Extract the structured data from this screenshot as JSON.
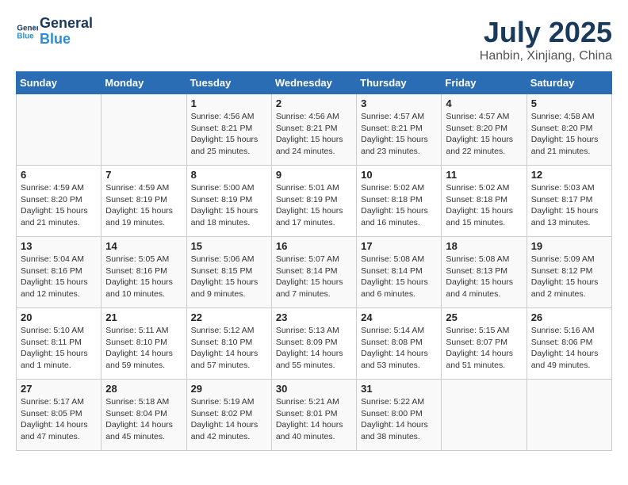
{
  "header": {
    "logo_line1": "General",
    "logo_line2": "Blue",
    "month": "July 2025",
    "location": "Hanbin, Xinjiang, China"
  },
  "days_of_week": [
    "Sunday",
    "Monday",
    "Tuesday",
    "Wednesday",
    "Thursday",
    "Friday",
    "Saturday"
  ],
  "weeks": [
    [
      {
        "day": "",
        "info": ""
      },
      {
        "day": "",
        "info": ""
      },
      {
        "day": "1",
        "info": "Sunrise: 4:56 AM\nSunset: 8:21 PM\nDaylight: 15 hours and 25 minutes."
      },
      {
        "day": "2",
        "info": "Sunrise: 4:56 AM\nSunset: 8:21 PM\nDaylight: 15 hours and 24 minutes."
      },
      {
        "day": "3",
        "info": "Sunrise: 4:57 AM\nSunset: 8:21 PM\nDaylight: 15 hours and 23 minutes."
      },
      {
        "day": "4",
        "info": "Sunrise: 4:57 AM\nSunset: 8:20 PM\nDaylight: 15 hours and 22 minutes."
      },
      {
        "day": "5",
        "info": "Sunrise: 4:58 AM\nSunset: 8:20 PM\nDaylight: 15 hours and 21 minutes."
      }
    ],
    [
      {
        "day": "6",
        "info": "Sunrise: 4:59 AM\nSunset: 8:20 PM\nDaylight: 15 hours and 21 minutes."
      },
      {
        "day": "7",
        "info": "Sunrise: 4:59 AM\nSunset: 8:19 PM\nDaylight: 15 hours and 19 minutes."
      },
      {
        "day": "8",
        "info": "Sunrise: 5:00 AM\nSunset: 8:19 PM\nDaylight: 15 hours and 18 minutes."
      },
      {
        "day": "9",
        "info": "Sunrise: 5:01 AM\nSunset: 8:19 PM\nDaylight: 15 hours and 17 minutes."
      },
      {
        "day": "10",
        "info": "Sunrise: 5:02 AM\nSunset: 8:18 PM\nDaylight: 15 hours and 16 minutes."
      },
      {
        "day": "11",
        "info": "Sunrise: 5:02 AM\nSunset: 8:18 PM\nDaylight: 15 hours and 15 minutes."
      },
      {
        "day": "12",
        "info": "Sunrise: 5:03 AM\nSunset: 8:17 PM\nDaylight: 15 hours and 13 minutes."
      }
    ],
    [
      {
        "day": "13",
        "info": "Sunrise: 5:04 AM\nSunset: 8:16 PM\nDaylight: 15 hours and 12 minutes."
      },
      {
        "day": "14",
        "info": "Sunrise: 5:05 AM\nSunset: 8:16 PM\nDaylight: 15 hours and 10 minutes."
      },
      {
        "day": "15",
        "info": "Sunrise: 5:06 AM\nSunset: 8:15 PM\nDaylight: 15 hours and 9 minutes."
      },
      {
        "day": "16",
        "info": "Sunrise: 5:07 AM\nSunset: 8:14 PM\nDaylight: 15 hours and 7 minutes."
      },
      {
        "day": "17",
        "info": "Sunrise: 5:08 AM\nSunset: 8:14 PM\nDaylight: 15 hours and 6 minutes."
      },
      {
        "day": "18",
        "info": "Sunrise: 5:08 AM\nSunset: 8:13 PM\nDaylight: 15 hours and 4 minutes."
      },
      {
        "day": "19",
        "info": "Sunrise: 5:09 AM\nSunset: 8:12 PM\nDaylight: 15 hours and 2 minutes."
      }
    ],
    [
      {
        "day": "20",
        "info": "Sunrise: 5:10 AM\nSunset: 8:11 PM\nDaylight: 15 hours and 1 minute."
      },
      {
        "day": "21",
        "info": "Sunrise: 5:11 AM\nSunset: 8:10 PM\nDaylight: 14 hours and 59 minutes."
      },
      {
        "day": "22",
        "info": "Sunrise: 5:12 AM\nSunset: 8:10 PM\nDaylight: 14 hours and 57 minutes."
      },
      {
        "day": "23",
        "info": "Sunrise: 5:13 AM\nSunset: 8:09 PM\nDaylight: 14 hours and 55 minutes."
      },
      {
        "day": "24",
        "info": "Sunrise: 5:14 AM\nSunset: 8:08 PM\nDaylight: 14 hours and 53 minutes."
      },
      {
        "day": "25",
        "info": "Sunrise: 5:15 AM\nSunset: 8:07 PM\nDaylight: 14 hours and 51 minutes."
      },
      {
        "day": "26",
        "info": "Sunrise: 5:16 AM\nSunset: 8:06 PM\nDaylight: 14 hours and 49 minutes."
      }
    ],
    [
      {
        "day": "27",
        "info": "Sunrise: 5:17 AM\nSunset: 8:05 PM\nDaylight: 14 hours and 47 minutes."
      },
      {
        "day": "28",
        "info": "Sunrise: 5:18 AM\nSunset: 8:04 PM\nDaylight: 14 hours and 45 minutes."
      },
      {
        "day": "29",
        "info": "Sunrise: 5:19 AM\nSunset: 8:02 PM\nDaylight: 14 hours and 42 minutes."
      },
      {
        "day": "30",
        "info": "Sunrise: 5:21 AM\nSunset: 8:01 PM\nDaylight: 14 hours and 40 minutes."
      },
      {
        "day": "31",
        "info": "Sunrise: 5:22 AM\nSunset: 8:00 PM\nDaylight: 14 hours and 38 minutes."
      },
      {
        "day": "",
        "info": ""
      },
      {
        "day": "",
        "info": ""
      }
    ]
  ]
}
